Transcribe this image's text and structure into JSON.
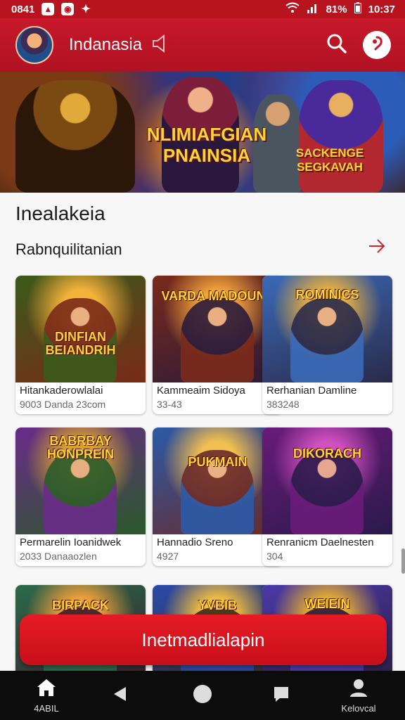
{
  "status_bar": {
    "time_left": "0841",
    "battery": "81%",
    "time_right": "10:37"
  },
  "app_bar": {
    "title": "Indanasia"
  },
  "banner": {
    "title": "NLIMIAFGIAN PNAINSIA",
    "subtitle": "SACKENGE SEGKAVAH"
  },
  "section": {
    "title": "Inealakeia",
    "subtitle": "Rabnquilitanian"
  },
  "cards": [
    {
      "title": "Hitankaderowlalai",
      "meta": "9003 Danda 23com",
      "art": "DINFIAN BEIANDRIH",
      "colors": [
        "#f3b23a",
        "#3a5a1a",
        "#7a2a18"
      ]
    },
    {
      "title": "Kammeaim Sidoya",
      "meta": "33-43",
      "art": "VARDA MADOUNS",
      "colors": [
        "#f2a23a",
        "#7a2a1a",
        "#2a1a3a"
      ]
    },
    {
      "title": "Rerhanian Damline",
      "meta": "383248",
      "art": "ROMINICS",
      "colors": [
        "#e8b040",
        "#3a6ab8",
        "#2a2a4a"
      ]
    },
    {
      "title": "Permarelin Ioanidwek",
      "meta": "2033 Danaaozlen",
      "art": "BABRBAY HONPREIN",
      "colors": [
        "#d8a030",
        "#6a2a8a",
        "#2a5a2a"
      ]
    },
    {
      "title": "Hannadio Sreno",
      "meta": "4927",
      "art": "PUKMAIN",
      "colors": [
        "#f2c050",
        "#2a5aa8",
        "#6a2a2a"
      ]
    },
    {
      "title": "Renranicm Daelnesten",
      "meta": "304",
      "art": "DIKORACH",
      "colors": [
        "#d050c0",
        "#6a1a7a",
        "#2a1a4a"
      ]
    },
    {
      "title": "",
      "meta": "",
      "art": "BIRPACK",
      "colors": [
        "#f2a23a",
        "#2a6a4a",
        "#3a1a2a"
      ]
    },
    {
      "title": "",
      "meta": "",
      "art": "YVBIB",
      "colors": [
        "#f2c040",
        "#2a4aa8",
        "#3a2a1a"
      ]
    },
    {
      "title": "",
      "meta": "",
      "art": "WEIEIN",
      "colors": [
        "#e8b030",
        "#4a3aa8",
        "#2a1a3a"
      ]
    }
  ],
  "cta": {
    "label": "Inetmadlialapin"
  },
  "bottom_nav": {
    "home_label": "4ABIL",
    "profile_label": "Kelovcal"
  }
}
